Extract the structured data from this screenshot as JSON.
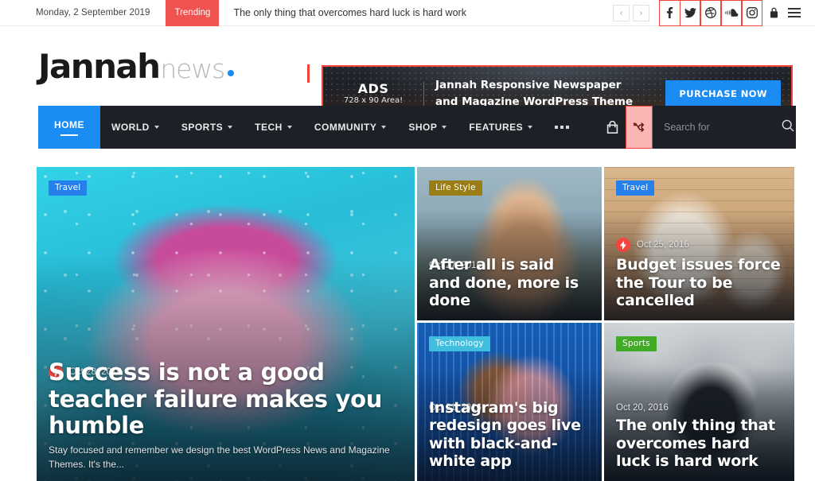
{
  "topbar": {
    "date": "Monday, 2 September 2019",
    "trending_label": "Trending",
    "trending_headline": "The only thing that overcomes hard luck is hard work",
    "prev_label": "‹",
    "next_label": "›",
    "social": [
      {
        "name": "facebook-icon",
        "label": "f"
      },
      {
        "name": "twitter-icon",
        "label": "t"
      },
      {
        "name": "dribbble-icon",
        "label": "d"
      },
      {
        "name": "soundcloud-icon",
        "label": "s"
      },
      {
        "name": "instagram-icon",
        "label": "i"
      }
    ],
    "login_icon": "lock-icon",
    "menu_icon": "hamburger-icon"
  },
  "logo": {
    "main": "Jannah",
    "sub": "news",
    "dot_color": "#1b8cf3"
  },
  "ad": {
    "label_line1": "ADS",
    "label_line2": "728 x 90 Area!",
    "title": "Jannah Responsive Newspaper and Magazine WordPress Theme",
    "button": "PURCHASE NOW",
    "button_color": "#1b8cf3"
  },
  "nav": {
    "items": [
      {
        "label": "HOME",
        "active": true,
        "has_caret": false
      },
      {
        "label": "WORLD",
        "active": false,
        "has_caret": true
      },
      {
        "label": "SPORTS",
        "active": false,
        "has_caret": true
      },
      {
        "label": "TECH",
        "active": false,
        "has_caret": true
      },
      {
        "label": "COMMUNITY",
        "active": false,
        "has_caret": true
      },
      {
        "label": "SHOP",
        "active": false,
        "has_caret": true
      },
      {
        "label": "FEATURES",
        "active": false,
        "has_caret": true
      }
    ],
    "more_label": "•••",
    "cart_icon": "shopping-bag-icon",
    "random_icon": "shuffle-icon",
    "search_placeholder": "Search for",
    "search_value": "",
    "search_icon": "search-icon",
    "bg_color": "#1d2026",
    "active_color": "#1b8cf3"
  },
  "articles": [
    {
      "id": "success-teacher",
      "category": "Travel",
      "category_color": "#2680eb",
      "date": "Oct 28, 2016",
      "title": "Success is not a good teacher failure makes you humble",
      "excerpt": "Stay focused and remember we design the best WordPress News and Magazine Themes. It's the...",
      "has_bolt": true
    },
    {
      "id": "after-all-said",
      "category": "Life Style",
      "category_color": "#9a7d13",
      "date": "Oct 27, 2016",
      "title": "After all is said and done, more is done",
      "excerpt": "",
      "has_bolt": false
    },
    {
      "id": "budget-issues",
      "category": "Travel",
      "category_color": "#2680eb",
      "date": "Oct 25, 2016",
      "title": "Budget issues force the Tour to be cancelled",
      "excerpt": "",
      "has_bolt": true
    },
    {
      "id": "instagram-redesign",
      "category": "Technology",
      "category_color": "#41bede",
      "date": "Oct 21, 2016",
      "title": "Instagram's big redesign goes live with black-and-white app",
      "excerpt": "",
      "has_bolt": false
    },
    {
      "id": "hard-luck-hard-work",
      "category": "Sports",
      "category_color": "#41aa27",
      "date": "Oct 20, 2016",
      "title": "The only thing that overcomes hard luck is hard work",
      "excerpt": "",
      "has_bolt": false
    }
  ]
}
